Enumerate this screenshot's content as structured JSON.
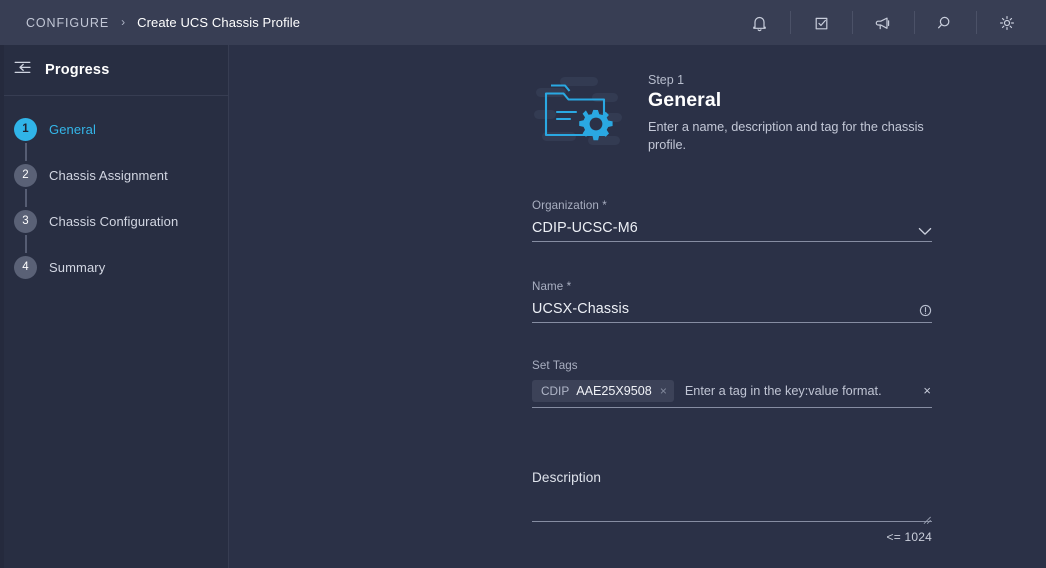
{
  "topbar": {
    "breadcrumb": {
      "root": "CONFIGURE",
      "separator": "›",
      "current": "Create UCS Chassis Profile"
    },
    "icons": [
      {
        "name": "bell-icon",
        "label": "Alarms"
      },
      {
        "name": "checklist-icon",
        "label": "Tasks"
      },
      {
        "name": "megaphone-icon",
        "label": "Announcements"
      },
      {
        "name": "search-icon",
        "label": "Search"
      },
      {
        "name": "gear-icon",
        "label": "Settings"
      }
    ]
  },
  "sidebar": {
    "title": "Progress",
    "collapse_icon": "collapse-panel-icon",
    "steps": [
      {
        "number": "1",
        "label": "General",
        "active": true
      },
      {
        "number": "2",
        "label": "Chassis Assignment",
        "active": false
      },
      {
        "number": "3",
        "label": "Chassis Configuration",
        "active": false
      },
      {
        "number": "4",
        "label": "Summary",
        "active": false
      }
    ]
  },
  "main": {
    "illustration": "folder-gear-illustration",
    "step_kicker": "Step 1",
    "step_heading": "General",
    "step_description": "Enter a name, description and tag for the chassis profile.",
    "organization": {
      "label": "Organization *",
      "value": "CDIP-UCSC-M6",
      "dropdown_icon": "chevron-down-icon"
    },
    "name": {
      "label": "Name *",
      "value": "UCSX-Chassis",
      "info_icon": "info-circle-icon"
    },
    "tags": {
      "label": "Set Tags",
      "chips": [
        {
          "key": "CDIP",
          "value": "AAE25X9508",
          "remove": "×"
        }
      ],
      "placeholder": "Enter a tag in the key:value format.",
      "clear_icon": "×"
    },
    "description": {
      "label": "Description",
      "value": "",
      "counter": "<= 1024"
    }
  },
  "colors": {
    "accent": "#30b4e8",
    "topbar_bg": "#383e54",
    "sidebar_bg": "#282e42",
    "main_bg": "#2b3147",
    "underline": "#868da2",
    "step_inactive": "#5a6176"
  }
}
